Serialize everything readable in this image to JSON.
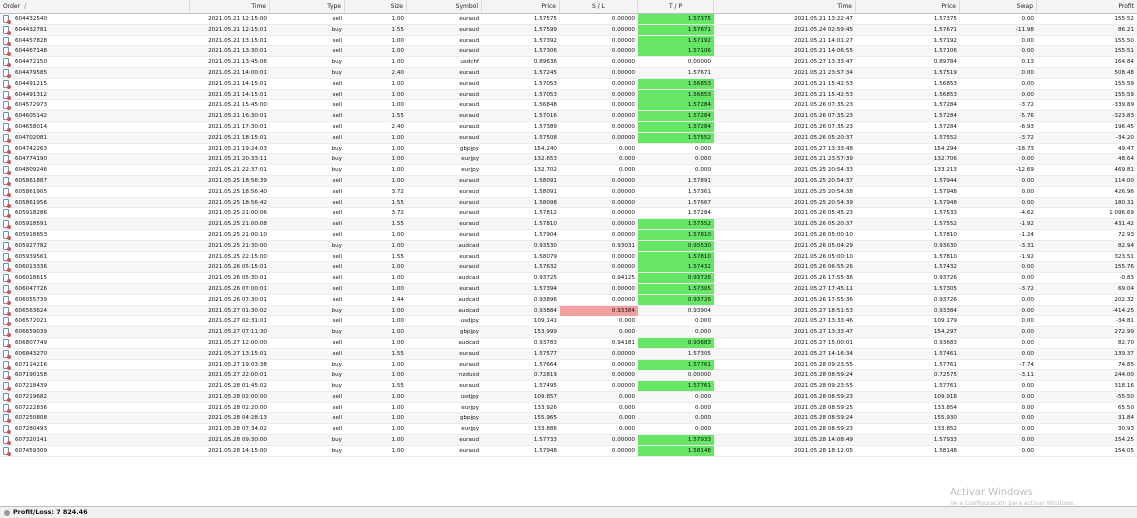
{
  "columns": {
    "order": "Order",
    "sort_mark": "/",
    "time": "Time",
    "type": "Type",
    "size": "Size",
    "symbol": "Symbol",
    "price": "Price",
    "sl": "S / L",
    "tp": "T / P",
    "close_time": "Time",
    "close_price": "Price",
    "swap": "Swap",
    "profit": "Profit"
  },
  "rows": [
    {
      "order": "604432540",
      "time": "2021.05.21 12:15:00",
      "type": "sell",
      "size": "1.00",
      "symbol": "euraud",
      "price": "1.57575",
      "sl": "0.00000",
      "tp": "1.57375",
      "tp_hit": true,
      "sl_hit": false,
      "close_time": "2021.05.21 13:22:47",
      "close_price": "1.57375",
      "swap": "0.00",
      "profit": "155.52"
    },
    {
      "order": "604432781",
      "time": "2021.05.21 12:15:01",
      "type": "buy",
      "size": "1.55",
      "symbol": "euraud",
      "price": "1.57599",
      "sl": "0.00000",
      "tp": "1.57671",
      "tp_hit": true,
      "sl_hit": false,
      "close_time": "2021.05.24 02:59:45",
      "close_price": "1.57671",
      "swap": "-11.98",
      "profit": "86.21"
    },
    {
      "order": "604457828",
      "time": "2021.05.21 13:15:01",
      "type": "sell",
      "size": "1.00",
      "symbol": "euraud",
      "price": "1.57392",
      "sl": "0.00000",
      "tp": "1.57192",
      "tp_hit": true,
      "sl_hit": false,
      "close_time": "2021.05.21 14:01:27",
      "close_price": "1.57192",
      "swap": "0.00",
      "profit": "155.50"
    },
    {
      "order": "604467148",
      "time": "2021.05.21 13:30:01",
      "type": "sell",
      "size": "1.00",
      "symbol": "euraud",
      "price": "1.57306",
      "sl": "0.00000",
      "tp": "1.57106",
      "tp_hit": true,
      "sl_hit": false,
      "close_time": "2021.05.21 14:06:55",
      "close_price": "1.57106",
      "swap": "0.00",
      "profit": "155.51"
    },
    {
      "order": "604472150",
      "time": "2021.05.21 13:45:06",
      "type": "buy",
      "size": "1.00",
      "symbol": "usdchf",
      "price": "0.89636",
      "sl": "0.00000",
      "tp": "0.00000",
      "tp_hit": false,
      "sl_hit": false,
      "close_time": "2021.05.27 13:33:47",
      "close_price": "0.89784",
      "swap": "0.13",
      "profit": "164.84"
    },
    {
      "order": "604479585",
      "time": "2021.05.21 14:00:01",
      "type": "buy",
      "size": "2.40",
      "symbol": "euraud",
      "price": "1.57245",
      "sl": "0.00000",
      "tp": "1.57671",
      "tp_hit": false,
      "sl_hit": false,
      "close_time": "2021.05.21 23:57:34",
      "close_price": "1.57519",
      "swap": "0.00",
      "profit": "508.48"
    },
    {
      "order": "604491215",
      "time": "2021.05.21 14:15:01",
      "type": "sell",
      "size": "1.00",
      "symbol": "euraud",
      "price": "1.57053",
      "sl": "0.00000",
      "tp": "1.56853",
      "tp_hit": true,
      "sl_hit": false,
      "close_time": "2021.05.21 15:42:53",
      "close_price": "1.56853",
      "swap": "0.00",
      "profit": "155.59"
    },
    {
      "order": "604491312",
      "time": "2021.05.21 14:15:01",
      "type": "sell",
      "size": "1.00",
      "symbol": "euraud",
      "price": "1.57053",
      "sl": "0.00000",
      "tp": "1.56853",
      "tp_hit": true,
      "sl_hit": false,
      "close_time": "2021.05.21 15:42:53",
      "close_price": "1.56853",
      "swap": "0.00",
      "profit": "155.59"
    },
    {
      "order": "604572973",
      "time": "2021.05.21 15:45:00",
      "type": "sell",
      "size": "1.00",
      "symbol": "euraud",
      "price": "1.56848",
      "sl": "0.00000",
      "tp": "1.57284",
      "tp_hit": true,
      "sl_hit": false,
      "close_time": "2021.05.26 07:35:23",
      "close_price": "1.57284",
      "swap": "-3.72",
      "profit": "-339.89"
    },
    {
      "order": "604605142",
      "time": "2021.05.21 16:30:01",
      "type": "sell",
      "size": "1.55",
      "symbol": "euraud",
      "price": "1.57016",
      "sl": "0.00000",
      "tp": "1.57284",
      "tp_hit": true,
      "sl_hit": false,
      "close_time": "2021.05.26 07:35:23",
      "close_price": "1.57284",
      "swap": "-5.76",
      "profit": "-323.83"
    },
    {
      "order": "604658014",
      "time": "2021.05.21 17:30:01",
      "type": "sell",
      "size": "2.40",
      "symbol": "euraud",
      "price": "1.57389",
      "sl": "0.00000",
      "tp": "1.57284",
      "tp_hit": true,
      "sl_hit": false,
      "close_time": "2021.05.26 07:35:23",
      "close_price": "1.57284",
      "swap": "-8.93",
      "profit": "196.45"
    },
    {
      "order": "604702081",
      "time": "2021.05.21 18:15:01",
      "type": "sell",
      "size": "1.00",
      "symbol": "euraud",
      "price": "1.57508",
      "sl": "0.00000",
      "tp": "1.57552",
      "tp_hit": true,
      "sl_hit": false,
      "close_time": "2021.05.26 05:20:37",
      "close_price": "1.57552",
      "swap": "-3.72",
      "profit": "-34.20"
    },
    {
      "order": "604742263",
      "time": "2021.05.21 19:24:03",
      "type": "buy",
      "size": "1.00",
      "symbol": "gbpjpy",
      "price": "154.240",
      "sl": "0.000",
      "tp": "0.000",
      "tp_hit": false,
      "sl_hit": false,
      "close_time": "2021.05.27 13:33:48",
      "close_price": "154.294",
      "swap": "-18.73",
      "profit": "49.47"
    },
    {
      "order": "604774190",
      "time": "2021.05.21 20:33:11",
      "type": "buy",
      "size": "1.00",
      "symbol": "eurjpy",
      "price": "132.653",
      "sl": "0.000",
      "tp": "0.000",
      "tp_hit": false,
      "sl_hit": false,
      "close_time": "2021.05.21 23:57:39",
      "close_price": "132.706",
      "swap": "0.00",
      "profit": "48.64"
    },
    {
      "order": "604809246",
      "time": "2021.05.21 22:37:01",
      "type": "buy",
      "size": "1.00",
      "symbol": "eurjpy",
      "price": "132.702",
      "sl": "0.000",
      "tp": "0.000",
      "tp_hit": false,
      "sl_hit": false,
      "close_time": "2021.05.25 20:54:33",
      "close_price": "133.213",
      "swap": "-12.69",
      "profit": "469.81"
    },
    {
      "order": "605861887",
      "time": "2021.05.25 18:56:39",
      "type": "sell",
      "size": "1.00",
      "symbol": "euraud",
      "price": "1.58091",
      "sl": "0.00000",
      "tp": "1.57891",
      "tp_hit": false,
      "sl_hit": false,
      "close_time": "2021.05.25 20:54:37",
      "close_price": "1.57944",
      "swap": "0.00",
      "profit": "114.00"
    },
    {
      "order": "605861905",
      "time": "2021.05.25 18:56:40",
      "type": "sell",
      "size": "3.72",
      "symbol": "euraud",
      "price": "1.58091",
      "sl": "0.00000",
      "tp": "1.57361",
      "tp_hit": false,
      "sl_hit": false,
      "close_time": "2021.05.25 20:54:38",
      "close_price": "1.57948",
      "swap": "0.00",
      "profit": "426.96"
    },
    {
      "order": "605861956",
      "time": "2021.05.25 18:56:42",
      "type": "sell",
      "size": "1.55",
      "symbol": "euraud",
      "price": "1.58098",
      "sl": "0.00000",
      "tp": "1.57667",
      "tp_hit": false,
      "sl_hit": false,
      "close_time": "2021.05.25 20:54:39",
      "close_price": "1.57948",
      "swap": "0.00",
      "profit": "180.31"
    },
    {
      "order": "605918286",
      "time": "2021.05.25 21:00:06",
      "type": "sell",
      "size": "3.72",
      "symbol": "euraud",
      "price": "1.57812",
      "sl": "0.00000",
      "tp": "1.57284",
      "tp_hit": false,
      "sl_hit": false,
      "close_time": "2021.05.26 05:45:23",
      "close_price": "1.57533",
      "swap": "-4.62",
      "profit": "1 096.69"
    },
    {
      "order": "605918591",
      "time": "2021.05.25 21:00:08",
      "type": "sell",
      "size": "1.55",
      "symbol": "euraud",
      "price": "1.57810",
      "sl": "0.00000",
      "tp": "1.57552",
      "tp_hit": true,
      "sl_hit": false,
      "close_time": "2021.05.26 05:20:37",
      "close_price": "1.57552",
      "swap": "-1.92",
      "profit": "431.42"
    },
    {
      "order": "605918653",
      "time": "2021.05.25 21:00:10",
      "type": "sell",
      "size": "1.00",
      "symbol": "euraud",
      "price": "1.57904",
      "sl": "0.00000",
      "tp": "1.57810",
      "tp_hit": true,
      "sl_hit": false,
      "close_time": "2021.05.26 05:00:10",
      "close_price": "1.57810",
      "swap": "-1.24",
      "profit": "72.93"
    },
    {
      "order": "605927782",
      "time": "2021.05.25 21:30:00",
      "type": "buy",
      "size": "1.00",
      "symbol": "audcad",
      "price": "0.93530",
      "sl": "0.93031",
      "tp": "0.93530",
      "tp_hit": true,
      "sl_hit": false,
      "close_time": "2021.05.26 05:04:29",
      "close_price": "0.93630",
      "swap": "-3.31",
      "profit": "82.94"
    },
    {
      "order": "605939561",
      "time": "2021.05.25 22:15:00",
      "type": "sell",
      "size": "1.55",
      "symbol": "euraud",
      "price": "1.58079",
      "sl": "0.00000",
      "tp": "1.57810",
      "tp_hit": true,
      "sl_hit": false,
      "close_time": "2021.05.26 05:00:10",
      "close_price": "1.57810",
      "swap": "-1.92",
      "profit": "323.51"
    },
    {
      "order": "606013336",
      "time": "2021.05.26 05:15:01",
      "type": "sell",
      "size": "1.00",
      "symbol": "euraud",
      "price": "1.57632",
      "sl": "0.00000",
      "tp": "1.57432",
      "tp_hit": true,
      "sl_hit": false,
      "close_time": "2021.05.26 06:55:26",
      "close_price": "1.57432",
      "swap": "0.00",
      "profit": "155.76"
    },
    {
      "order": "606018615",
      "time": "2021.05.26 05:30:01",
      "type": "sell",
      "size": "1.00",
      "symbol": "audcad",
      "price": "0.93725",
      "sl": "0.94125",
      "tp": "0.93726",
      "tp_hit": true,
      "sl_hit": false,
      "close_time": "2021.05.26 17:55:36",
      "close_price": "0.93726",
      "swap": "0.00",
      "profit": "-0.83"
    },
    {
      "order": "606047726",
      "time": "2021.05.26 07:00:01",
      "type": "sell",
      "size": "1.00",
      "symbol": "euraud",
      "price": "1.57394",
      "sl": "0.00000",
      "tp": "1.57305",
      "tp_hit": true,
      "sl_hit": false,
      "close_time": "2021.05.27 17:45:11",
      "close_price": "1.57305",
      "swap": "-3.72",
      "profit": "69.04"
    },
    {
      "order": "606055739",
      "time": "2021.05.26 07:30:01",
      "type": "sell",
      "size": "1.44",
      "symbol": "audcad",
      "price": "0.93896",
      "sl": "0.00000",
      "tp": "0.93726",
      "tp_hit": true,
      "sl_hit": false,
      "close_time": "2021.05.26 17:55:36",
      "close_price": "0.93726",
      "swap": "0.00",
      "profit": "202.32"
    },
    {
      "order": "606563624",
      "time": "2021.05.27 01:30:02",
      "type": "buy",
      "size": "1.00",
      "symbol": "audcad",
      "price": "0.93884",
      "sl": "0.93384",
      "tp": "0.93904",
      "tp_hit": false,
      "sl_hit": true,
      "close_time": "2021.05.27 18:51:53",
      "close_price": "0.93384",
      "swap": "0.00",
      "profit": "-414.25"
    },
    {
      "order": "606572021",
      "time": "2021.05.27 02:31:01",
      "type": "sell",
      "size": "1.00",
      "symbol": "usdjpy",
      "price": "109.141",
      "sl": "0.000",
      "tp": "0.000",
      "tp_hit": false,
      "sl_hit": false,
      "close_time": "2021.05.27 13:33:46",
      "close_price": "109.179",
      "swap": "0.00",
      "profit": "-34.81"
    },
    {
      "order": "606659039",
      "time": "2021.05.27 07:11:30",
      "type": "buy",
      "size": "1.00",
      "symbol": "gbpjpy",
      "price": "153.999",
      "sl": "0.000",
      "tp": "0.000",
      "tp_hit": false,
      "sl_hit": false,
      "close_time": "2021.05.27 13:33:47",
      "close_price": "154.297",
      "swap": "0.00",
      "profit": "272.99"
    },
    {
      "order": "606807749",
      "time": "2021.05.27 12:00:00",
      "type": "sell",
      "size": "1.00",
      "symbol": "audcad",
      "price": "0.93783",
      "sl": "0.94181",
      "tp": "0.93683",
      "tp_hit": true,
      "sl_hit": false,
      "close_time": "2021.05.27 15:00:01",
      "close_price": "0.93683",
      "swap": "0.00",
      "profit": "82.70"
    },
    {
      "order": "606843270",
      "time": "2021.05.27 13:15:01",
      "type": "sell",
      "size": "1.55",
      "symbol": "euraud",
      "price": "1.57577",
      "sl": "0.00000",
      "tp": "1.57305",
      "tp_hit": false,
      "sl_hit": false,
      "close_time": "2021.05.27 14:16:34",
      "close_price": "1.57461",
      "swap": "0.00",
      "profit": "139.37"
    },
    {
      "order": "607114216",
      "time": "2021.05.27 19:03:38",
      "type": "buy",
      "size": "1.00",
      "symbol": "euraud",
      "price": "1.57664",
      "sl": "0.00000",
      "tp": "1.57761",
      "tp_hit": true,
      "sl_hit": false,
      "close_time": "2021.05.28 09:23:55",
      "close_price": "1.57761",
      "swap": "-7.74",
      "profit": "74.85"
    },
    {
      "order": "607190158",
      "time": "2021.05.27 22:00:01",
      "type": "buy",
      "size": "1.00",
      "symbol": "nzdusd",
      "price": "0.72819",
      "sl": "0.00000",
      "tp": "0.00000",
      "tp_hit": false,
      "sl_hit": false,
      "close_time": "2021.05.28 08:59:24",
      "close_price": "0.72575",
      "swap": "-3.11",
      "profit": "244.00"
    },
    {
      "order": "607218439",
      "time": "2021.05.28 01:45:02",
      "type": "buy",
      "size": "1.55",
      "symbol": "euraud",
      "price": "1.57495",
      "sl": "0.00000",
      "tp": "1.57761",
      "tp_hit": true,
      "sl_hit": false,
      "close_time": "2021.05.28 09:23:55",
      "close_price": "1.57761",
      "swap": "0.00",
      "profit": "318.16"
    },
    {
      "order": "607219682",
      "time": "2021.05.28 02:00:00",
      "type": "sell",
      "size": "1.00",
      "symbol": "usdjpy",
      "price": "109.857",
      "sl": "0.000",
      "tp": "0.000",
      "tp_hit": false,
      "sl_hit": false,
      "close_time": "2021.05.28 08:59:23",
      "close_price": "109.918",
      "swap": "0.00",
      "profit": "-55.50"
    },
    {
      "order": "607222836",
      "time": "2021.05.28 02:20:00",
      "type": "sell",
      "size": "1.00",
      "symbol": "eurjpy",
      "price": "133.926",
      "sl": "0.000",
      "tp": "0.000",
      "tp_hit": false,
      "sl_hit": false,
      "close_time": "2021.05.28 08:59:25",
      "close_price": "133.854",
      "swap": "0.00",
      "profit": "65.50"
    },
    {
      "order": "607250808",
      "time": "2021.05.28 04:28:13",
      "type": "sell",
      "size": "1.00",
      "symbol": "gbpjpy",
      "price": "155.965",
      "sl": "0.000",
      "tp": "0.000",
      "tp_hit": false,
      "sl_hit": false,
      "close_time": "2021.05.28 08:59:24",
      "close_price": "155.930",
      "swap": "0.00",
      "profit": "31.84"
    },
    {
      "order": "607280493",
      "time": "2021.05.28 07:34:02",
      "type": "sell",
      "size": "1.00",
      "symbol": "eurjpy",
      "price": "133.886",
      "sl": "0.000",
      "tp": "0.000",
      "tp_hit": false,
      "sl_hit": false,
      "close_time": "2021.05.28 08:59:23",
      "close_price": "133.852",
      "swap": "0.00",
      "profit": "30.93"
    },
    {
      "order": "607320141",
      "time": "2021.05.28 09:30:00",
      "type": "buy",
      "size": "1.00",
      "symbol": "euraud",
      "price": "1.57733",
      "sl": "0.00000",
      "tp": "1.57933",
      "tp_hit": true,
      "sl_hit": false,
      "close_time": "2021.05.28 14:08:49",
      "close_price": "1.57933",
      "swap": "0.00",
      "profit": "154.25"
    },
    {
      "order": "607459309",
      "time": "2021.05.28 14:15:00",
      "type": "buy",
      "size": "1.00",
      "symbol": "euraud",
      "price": "1.57948",
      "sl": "0.00000",
      "tp": "1.58148",
      "tp_hit": true,
      "sl_hit": false,
      "close_time": "2021.05.28 18:12:05",
      "close_price": "1.58148",
      "swap": "0.00",
      "profit": "154.05"
    }
  ],
  "footer": {
    "label": "Profit/Loss: 7 824.46"
  },
  "watermark": {
    "title": "Activar Windows",
    "subtitle": "Ve a Configuración para activar Windows."
  },
  "colors": {
    "tp_highlight": "#66e566",
    "sl_highlight": "#f2a0a0"
  }
}
